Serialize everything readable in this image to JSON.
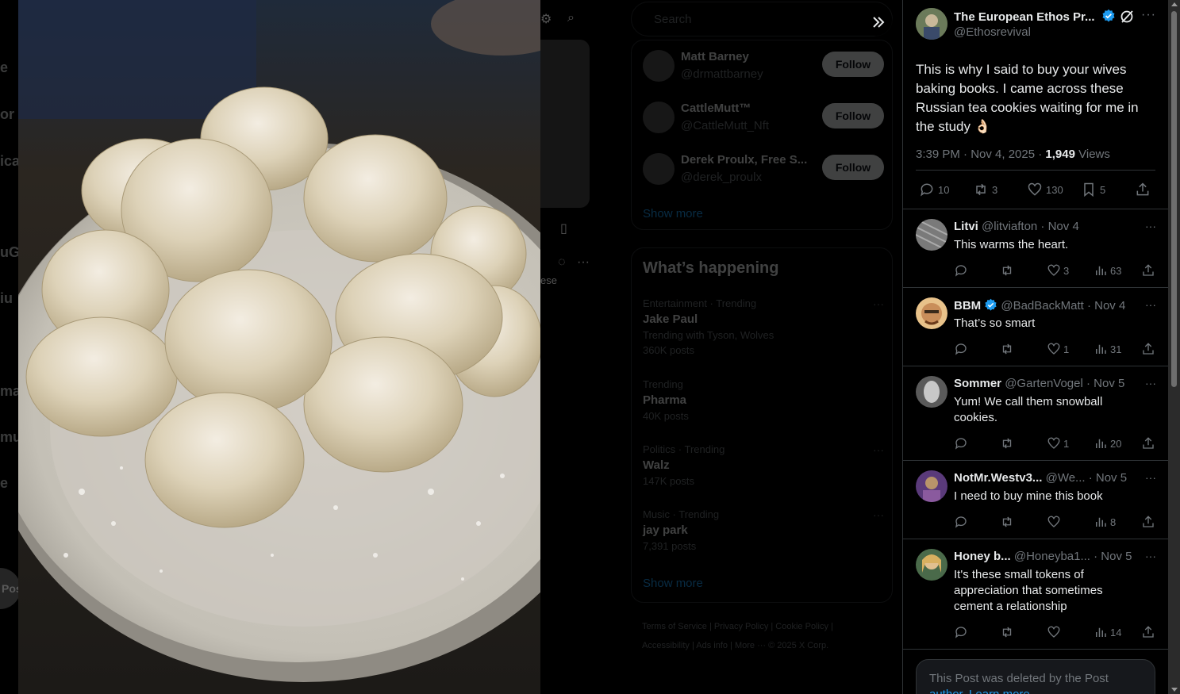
{
  "background": {
    "nav_fragments": [
      "e",
      "or",
      "ica",
      "uG",
      "iu",
      "ma",
      "mu",
      "e"
    ],
    "post_button": "Pos",
    "search_placeholder": "Search",
    "who_to_follow": [
      {
        "name": "Matt Barney",
        "handle": "@drmattbarney",
        "button": "Follow"
      },
      {
        "name": "CattleMutt™",
        "handle": "@CattleMutt_Nft",
        "button": "Follow"
      },
      {
        "name": "Derek Proulx, Free S...",
        "handle": "@derek_proulx",
        "button": "Follow"
      }
    ],
    "show_more": "Show more",
    "whats_happening": "What’s happening",
    "trends": [
      {
        "context": "Entertainment · Trending",
        "title": "Jake Paul",
        "sub": "Trending with Tyson, Wolves",
        "count": "360K posts"
      },
      {
        "context": "Trending",
        "title": "Pharma",
        "sub": "",
        "count": "40K posts"
      },
      {
        "context": "Politics · Trending",
        "title": "Walz",
        "sub": "",
        "count": "147K posts"
      },
      {
        "context": "Music · Trending",
        "title": "jay park",
        "sub": "",
        "count": "7,391 posts"
      }
    ],
    "show_more_2": "Show more",
    "footer_line1": "Terms of Service  |  Privacy Policy  |  Cookie Policy  |",
    "footer_line2": "Accessibility  |  Ads info  |  More ···  © 2025 X Corp.",
    "feed_fragment": "ese"
  },
  "post": {
    "author_name": "The European Ethos Pr...",
    "author_handle": "@Ethosrevival",
    "text": "This is why I said to buy your wives baking books. I came across these Russian tea cookies waiting for me in the study 👌🏻",
    "time": "3:39 PM · Nov 4, 2025 · ",
    "views_count": "1,949",
    "views_label": " Views",
    "replies": "10",
    "reposts": "3",
    "likes": "130",
    "bookmarks": "5",
    "more": "···"
  },
  "replies": [
    {
      "name": "Litvi",
      "handle": "@litviafton · Nov 4",
      "text": "This warms the heart.",
      "reposts": "",
      "likes": "3",
      "views": "63",
      "verified": false,
      "avatar_color": "#7a7a7a"
    },
    {
      "name": "BBM",
      "handle": "@BadBackMatt · Nov 4",
      "text": "That’s so smart",
      "reposts": "",
      "likes": "1",
      "views": "31",
      "verified": true,
      "avatar_color": "#d9a46a"
    },
    {
      "name": "Sommer",
      "handle": "@GartenVogel · Nov 5",
      "text": "Yum!  We call them snowball cookies.",
      "reposts": "",
      "likes": "1",
      "views": "20",
      "verified": false,
      "avatar_color": "#9a9a9a"
    },
    {
      "name": "NotMr.Westv3...",
      "handle": " @We...   · Nov 5",
      "text": "I need to buy mine this book",
      "reposts": "",
      "likes": "",
      "views": "8",
      "verified": false,
      "avatar_color": "#7d5a9e"
    },
    {
      "name": "Honey b...",
      "handle": "  @Honeyba1...  · Nov 5",
      "text": "It's these small tokens of appreciation that sometimes cement a relationship",
      "reposts": "",
      "likes": "",
      "views": "14",
      "verified": false,
      "avatar_color": "#c9a46b"
    }
  ],
  "deleted_notice": {
    "text": "This Post was deleted by the Post",
    "link": "author. Learn more"
  },
  "colors": {
    "accent": "#1d9bf0",
    "muted": "#71767b",
    "text": "#e7e9ea",
    "border": "#2f3336"
  }
}
